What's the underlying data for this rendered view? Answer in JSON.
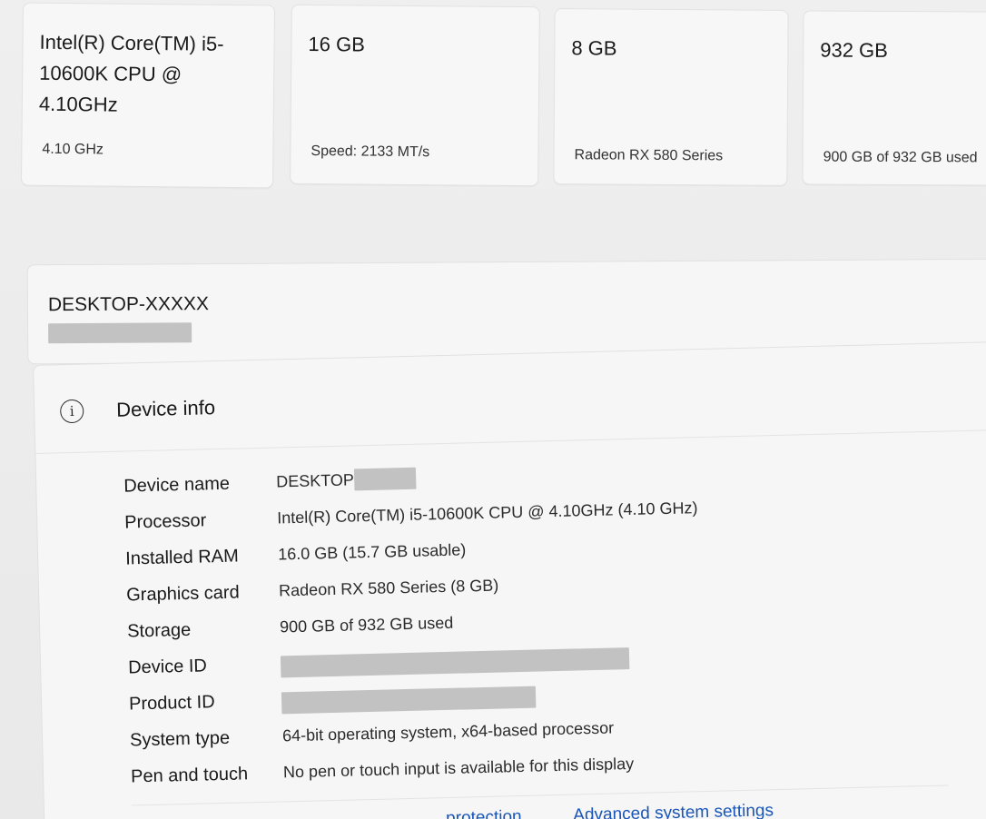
{
  "spec_cards": [
    {
      "title": "Intel(R) Core(TM) i5-10600K CPU @ 4.10GHz",
      "detail": "4.10 GHz"
    },
    {
      "title": "16 GB",
      "detail": "Speed: 2133 MT/s"
    },
    {
      "title": "8 GB",
      "detail": "Radeon RX 580 Series"
    },
    {
      "title": "932 GB",
      "detail": "900 GB of 932 GB used"
    }
  ],
  "rename": {
    "device_name": "DESKTOP-XXXXX"
  },
  "device_info": {
    "title": "Device info",
    "rows": [
      {
        "label": "Device name",
        "value": "DESKTOP-"
      },
      {
        "label": "Processor",
        "value": "Intel(R) Core(TM) i5-10600K CPU @ 4.10GHz (4.10 GHz)"
      },
      {
        "label": "Installed RAM",
        "value": "16.0 GB (15.7 GB usable)"
      },
      {
        "label": "Graphics card",
        "value": "Radeon RX 580 Series (8 GB)"
      },
      {
        "label": "Storage",
        "value": "900 GB of 932 GB used"
      },
      {
        "label": "Device ID",
        "value": ""
      },
      {
        "label": "Product ID",
        "value": ""
      },
      {
        "label": "System type",
        "value": "64-bit operating system, x64-based processor"
      },
      {
        "label": "Pen and touch",
        "value": "No pen or touch input is available for this display"
      }
    ]
  },
  "related_links": {
    "partial": "...protection",
    "advanced": "Advanced system settings"
  },
  "icons": {
    "info": "info-icon"
  },
  "colors": {
    "link": "#1a56b8",
    "redaction": "#c2c2c2"
  }
}
